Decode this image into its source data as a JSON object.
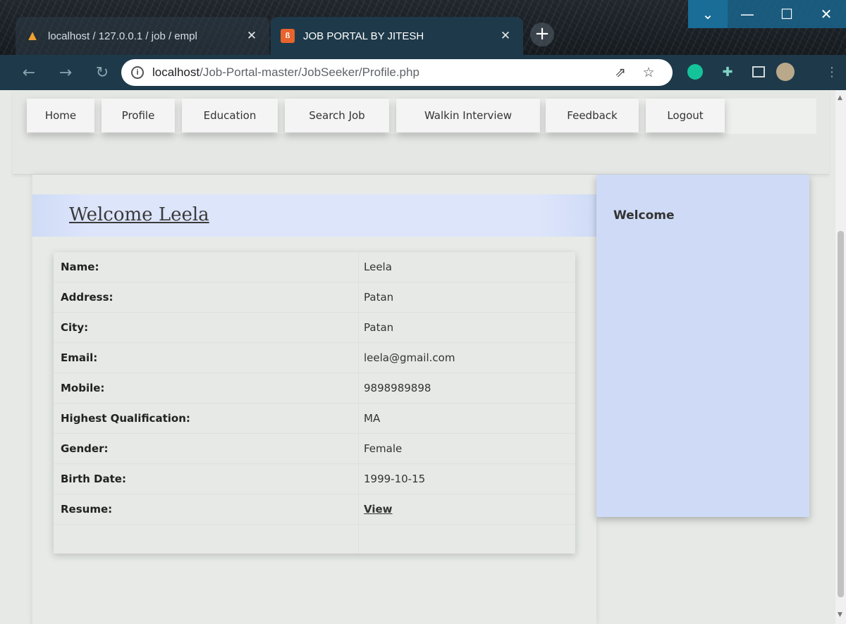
{
  "browser": {
    "tabs": [
      {
        "title": "localhost / 127.0.0.1 / job / empl",
        "favicon": "phpmyadmin-icon",
        "active": false
      },
      {
        "title": "JOB PORTAL BY JITESH",
        "favicon": "xampp-icon",
        "active": true
      }
    ],
    "url_host": "localhost",
    "url_path": "/Job-Portal-master/JobSeeker/Profile.php"
  },
  "nav": {
    "items": [
      "Home",
      "Profile",
      "Education",
      "Search Job",
      "Walkin Interview",
      "Feedback",
      "Logout"
    ]
  },
  "main": {
    "welcome": "Welcome Leela",
    "fields": [
      {
        "label": "Name:",
        "value": "Leela"
      },
      {
        "label": "Address:",
        "value": "Patan"
      },
      {
        "label": "City:",
        "value": "Patan"
      },
      {
        "label": "Email:",
        "value": "leela@gmail.com"
      },
      {
        "label": "Mobile:",
        "value": "9898989898"
      },
      {
        "label": "Highest Qualification:",
        "value": "MA"
      },
      {
        "label": "Gender:",
        "value": "Female"
      },
      {
        "label": "Birth Date:",
        "value": "1999-10-15"
      },
      {
        "label": "Resume:",
        "value": "View"
      }
    ]
  },
  "sidebar": {
    "title": "Welcome"
  },
  "colors": {
    "welcome_bar": "#dde5fb",
    "sidebar": "#cfdbf6",
    "page_bg": "#e6e9e6",
    "browser_toolbar": "#1e3a4a"
  }
}
